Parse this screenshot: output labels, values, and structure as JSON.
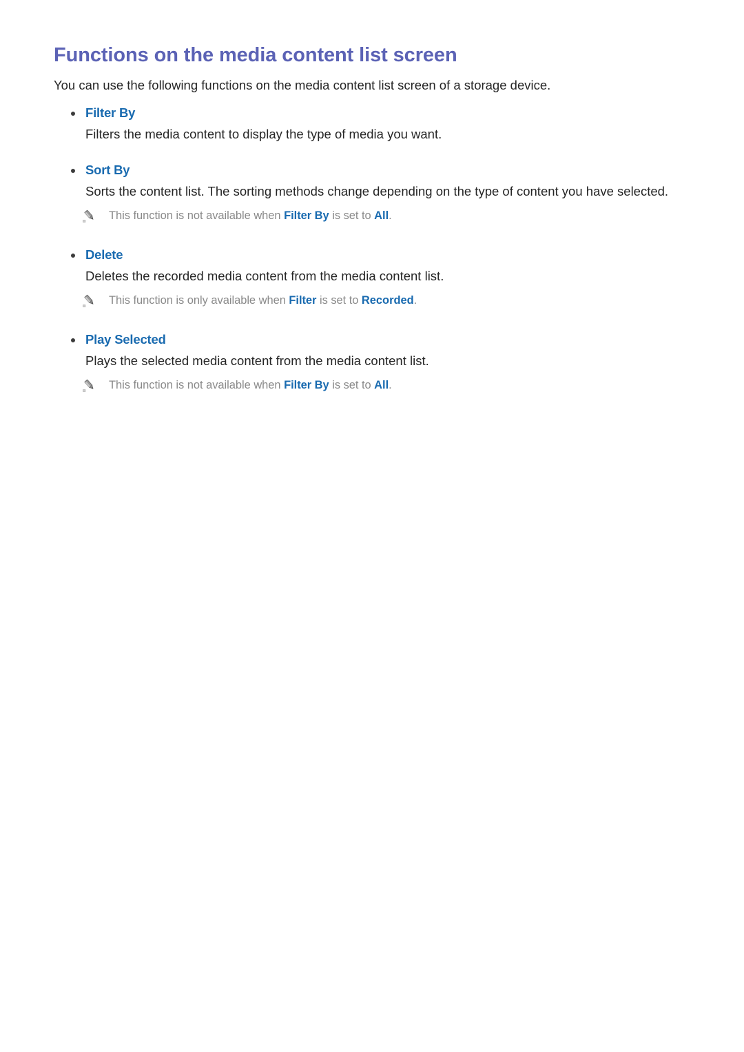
{
  "document": {
    "title": "Functions on the media content list screen",
    "intro": "You can use the following functions on the media content list screen of a storage device.",
    "title_color": "#5b62b5",
    "link_color": "#1a6bb0",
    "body_color": "#262626",
    "note_color": "#8a8a8a",
    "background": "#ffffff"
  },
  "sections": [
    {
      "label": "Filter By",
      "body": "Filters the media content to display the type of media you want.",
      "notes": []
    },
    {
      "label": "Sort By",
      "body": "Sorts the content list. The sorting methods change depending on the type of content you have selected.",
      "notes": [
        {
          "icon": "pencil-icon",
          "parts": [
            {
              "text": "This function is not available when ",
              "bold": false
            },
            {
              "text": "Filter By",
              "bold": true
            },
            {
              "text": " is set to ",
              "bold": false
            },
            {
              "text": "All",
              "bold": true
            },
            {
              "text": ".",
              "bold": false
            }
          ],
          "plain": "This function is not available when Filter By is set to All."
        }
      ]
    },
    {
      "label": "Delete",
      "body": "Deletes the recorded media content from the media content list.",
      "notes": [
        {
          "icon": "pencil-icon",
          "parts": [
            {
              "text": "This function is only available when ",
              "bold": false
            },
            {
              "text": "Filter",
              "bold": true
            },
            {
              "text": " is set to ",
              "bold": false
            },
            {
              "text": "Recorded",
              "bold": true
            },
            {
              "text": ".",
              "bold": false
            }
          ],
          "plain": "This function is only available when Filter is set to Recorded."
        }
      ]
    },
    {
      "label": "Play Selected",
      "body": "Plays the selected media content from the media content list.",
      "notes": [
        {
          "icon": "pencil-icon",
          "parts": [
            {
              "text": "This function is not available when ",
              "bold": false
            },
            {
              "text": "Filter By",
              "bold": true
            },
            {
              "text": " is set to ",
              "bold": false
            },
            {
              "text": "All",
              "bold": true
            },
            {
              "text": ".",
              "bold": false
            }
          ],
          "plain": "This function is not available when Filter By is set to All."
        }
      ]
    }
  ]
}
